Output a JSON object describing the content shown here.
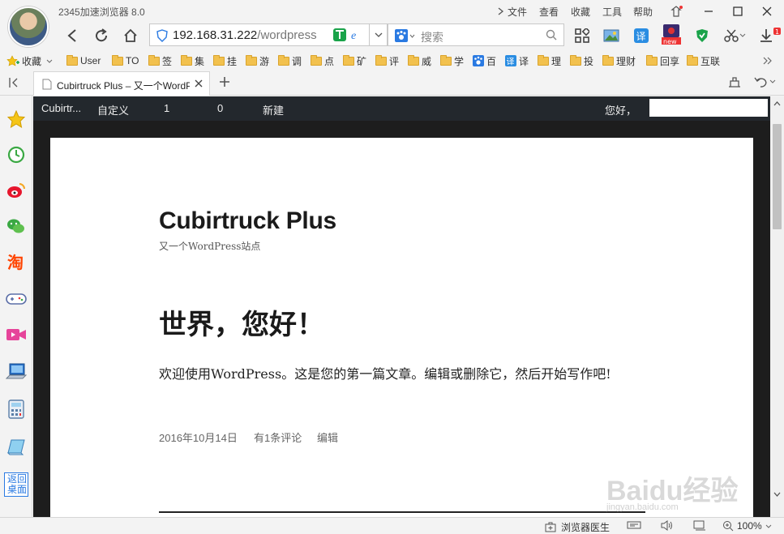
{
  "app": {
    "title": "2345加速浏览器 8.0"
  },
  "menu": [
    "文件",
    "查看",
    "收藏",
    "工具",
    "帮助"
  ],
  "address": {
    "host": "192.168.31.222",
    "path": "/wordpress"
  },
  "search": {
    "placeholder": "搜索"
  },
  "bookmarks": {
    "favorites_label": "收藏",
    "items": [
      "User",
      "TO",
      "签",
      "集",
      "挂",
      "游",
      "调",
      "点",
      "矿",
      "评",
      "威",
      "学",
      "百",
      "译",
      "理",
      "投",
      "理财",
      "回享",
      "互联"
    ]
  },
  "tab": {
    "title": "Cubirtruck Plus – 又一个WordPress站点"
  },
  "adminbar": {
    "site": "Cubirtr...",
    "customize": "自定义",
    "updates": "1",
    "comments": "0",
    "new": "新建",
    "greeting": "您好，"
  },
  "site": {
    "title": "Cubirtruck Plus",
    "description": "又一个WordPress站点"
  },
  "post": {
    "title": "世界，您好！",
    "body": "欢迎使用WordPress。这是您的第一篇文章。编辑或删除它，然后开始写作吧!",
    "date": "2016年10月14日",
    "comments": "有1条评论",
    "edit": "编辑"
  },
  "sidebar": {
    "desktop_label": "返回桌面"
  },
  "statusbar": {
    "doctor": "浏览器医生",
    "zoom": "100%"
  },
  "watermark": {
    "text": "Baidu经验",
    "sub": "jingyan.baidu.com"
  },
  "colors": {
    "accent_blue": "#2a7ae2",
    "admin_bar": "#23282d",
    "page_bg": "#1d1d1d"
  }
}
